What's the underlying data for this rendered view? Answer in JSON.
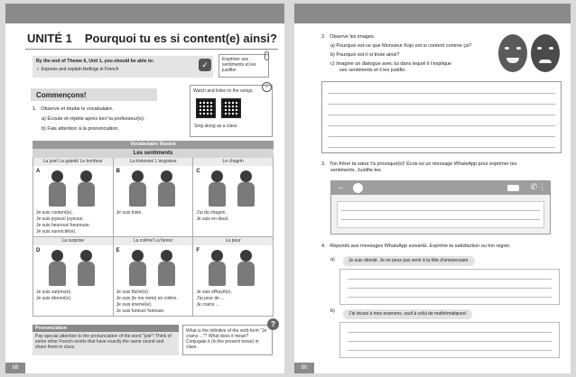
{
  "left_page": {
    "page_number": "68",
    "unit_label": "UNITÉ 1",
    "unit_title": "Pourquoi tu es si content(e) ainsi?",
    "theme_box": {
      "heading": "By the end of Theme 6, Unit 1, you should be able to:",
      "item": "✓  Express and explain feelings in French"
    },
    "side_note": "Exprimer ses sentiments et les justifier",
    "section_title": "Commençons!",
    "watch_box": {
      "title": "Watch and listen to the songs.",
      "caption": "Sing along as a class."
    },
    "exercise": {
      "number": "1.",
      "instruction": "Observe et étudie le vocabulaire.",
      "a": "a)   Écoute et répète après ton/ ta professeur(e).",
      "b": "b)   Fais attention à la prononciation."
    },
    "vocab": {
      "header": "Vocabulaire illustré",
      "subheader": "Les sentiments",
      "cells": [
        {
          "letter": "A",
          "label": "La joie/ La gaieté/ Le bonheur",
          "lines": [
            "Je suis content(e).",
            "Je suis joyeux/ joyeuse.",
            "Je suis heureux/ heureuse.",
            "Je suis surexcité(e)."
          ]
        },
        {
          "letter": "B",
          "label": "La tristesse/ L'angoisse",
          "lines": [
            "Je suis triste.",
            "",
            "",
            ""
          ]
        },
        {
          "letter": "C",
          "label": "Le chagrin",
          "lines": [
            "J'ai du chagrin.",
            "Je suis en deuil.",
            "",
            ""
          ]
        },
        {
          "letter": "D",
          "label": "La surprise",
          "lines": [
            "Je suis surpris(e).",
            "Je suis étonné(e).",
            "",
            ""
          ]
        },
        {
          "letter": "E",
          "label": "La colère/ La fureur",
          "lines": [
            "Je suis fâché(e).",
            "Je suis (le me mets) en colère.",
            "Je suis énervé(e).",
            "Je suis furieux/ furieuse."
          ]
        },
        {
          "letter": "F",
          "label": "La peur",
          "lines": [
            "Je suis effrayé(e).",
            "J'ai peur de ...",
            "Je crains ...",
            ""
          ]
        }
      ]
    },
    "pronunciation": {
      "title": "Prononciation",
      "body": "Pay special attention to the pronunciation of the word \"joie\"! Think of some other French words that have exactly the same sound and share them in class."
    },
    "infinitive_box": "What is the infinitive of the verb form \"Je crains ...\"? What does it mean? Conjugate it (in the present tense) in class."
  },
  "right_page": {
    "page_number": "80",
    "q2": {
      "number": "2.",
      "instruction": "Observe les images.",
      "a": "a)   Pourquoi est-ce que Monsieur Kojo est si content comme ça?",
      "b": "b)   Pourquoi est-il si triste ainsi?",
      "c1": "c)   Imagine un dialogue avec lui dans lequel il t'explique",
      "c2": "ses sentiments et il les justifie."
    },
    "q3": {
      "number": "3.",
      "line1": "Ton frère/ ta sœur t'a provoqué(e)! Écris-lui un message WhatsApp pour exprimer tes",
      "line2": "sentiments. Justifie-les."
    },
    "q4": {
      "number": "4.",
      "instruction": "Réponds aux messages WhatsApp suivants. Exprime ta satisfaction ou ton regret.",
      "a_label": "a)",
      "a_message": "Je suis désolé. Je ne peux pas venir à ta fête d'anniversaire.",
      "b_label": "b)",
      "b_message": "J'ai réussi à mes examens, sauf à celui de mathématiques!"
    }
  }
}
